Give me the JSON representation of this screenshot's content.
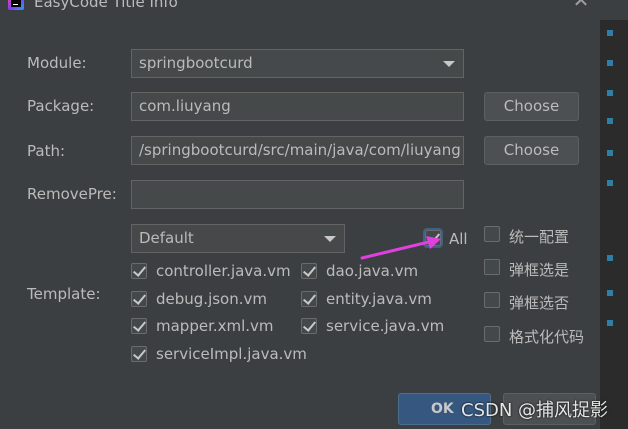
{
  "window": {
    "title": "EasyCode Title Info",
    "close_icon": "close-icon"
  },
  "form": {
    "module_label": "Module:",
    "module_value": "springbootcurd",
    "package_label": "Package:",
    "package_value": "com.liuyang",
    "package_button": "Choose",
    "path_label": "Path:",
    "path_value": "/springbootcurd/src/main/java/com/liuyang",
    "path_button": "Choose",
    "removepre_label": "RemovePre:",
    "removepre_value": ""
  },
  "template": {
    "label": "Template:",
    "group_value": "Default",
    "all_label": "All",
    "all_checked": true,
    "items": [
      {
        "label": "controller.java.vm",
        "checked": true
      },
      {
        "label": "dao.java.vm",
        "checked": true
      },
      {
        "label": "debug.json.vm",
        "checked": true
      },
      {
        "label": "entity.java.vm",
        "checked": true
      },
      {
        "label": "mapper.xml.vm",
        "checked": true
      },
      {
        "label": "service.java.vm",
        "checked": true
      },
      {
        "label": "serviceImpl.java.vm",
        "checked": true
      }
    ]
  },
  "options": [
    {
      "label": "统一配置",
      "checked": false
    },
    {
      "label": "弹框选是",
      "checked": false
    },
    {
      "label": "弹框选否",
      "checked": false
    },
    {
      "label": "格式化代码",
      "checked": false
    }
  ],
  "footer": {
    "ok_label": "OK",
    "watermark": "CSDN @捕风捉影"
  },
  "colors": {
    "background": "#3c3f41",
    "field": "#45494a",
    "ok_button": "#365880",
    "annotation_arrow": "#e040e0"
  }
}
